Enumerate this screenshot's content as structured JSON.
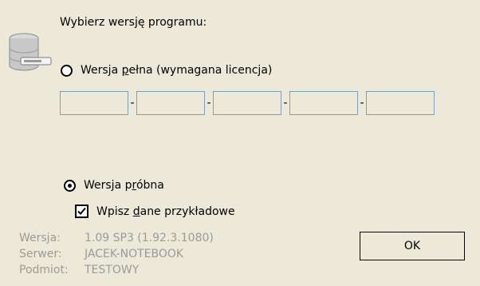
{
  "prompt": "Wybierz wersję programu:",
  "full_option": {
    "label_pre": "Wersja ",
    "label_mnemonic": "p",
    "label_post": "ełna (wymagana licencja)",
    "checked": false
  },
  "license_fields": [
    "",
    "",
    "",
    "",
    ""
  ],
  "license_separator": "-",
  "trial_option": {
    "label_pre": "Wersja p",
    "label_mnemonic": "r",
    "label_post": "óbna",
    "checked": true
  },
  "sample_data": {
    "label_pre": "Wpisz ",
    "label_mnemonic": "d",
    "label_post": "ane przykładowe",
    "checked": true
  },
  "info": {
    "version_label": "Wersja:",
    "version_value": "1.09 SP3 (1.92.3.1080)",
    "server_label": "Serwer:",
    "server_value": "JACEK-NOTEBOOK",
    "subject_label": "Podmiot:",
    "subject_value": "TESTOWY"
  },
  "ok_label": "OK",
  "icons": {
    "database": "database-server-icon",
    "check": "checkmark-icon"
  }
}
